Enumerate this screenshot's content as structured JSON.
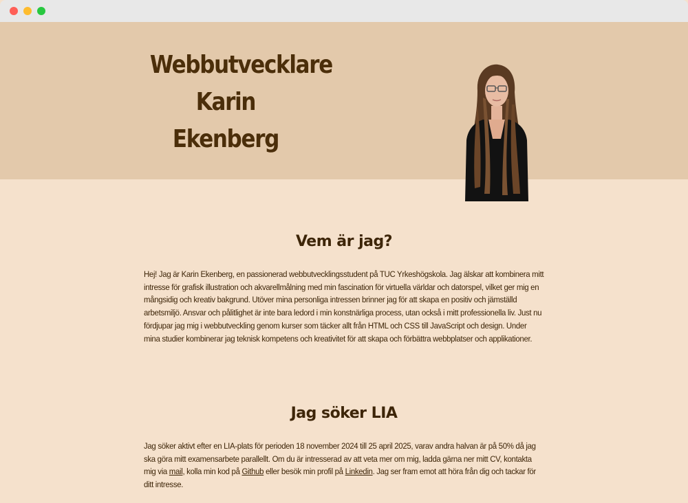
{
  "hero": {
    "title_line1": "Webbutvecklare",
    "title_line2": "Karin Ekenberg"
  },
  "about": {
    "heading": "Vem är jag?",
    "text": "Hej! Jag är Karin Ekenberg, en passionerad webbutvecklingsstudent på TUC Yrkeshögskola. Jag älskar att kombinera mitt intresse för grafisk illustration och akvarellmålning med min fascination för virtuella världar och datorspel, vilket ger mig en mångsidig och kreativ bakgrund. Utöver mina personliga intressen brinner jag för att skapa en positiv och jämställd arbetsmiljö. Ansvar och pålitlighet är inte bara ledord i min konstnärliga process, utan också i mitt professionella liv. Just nu fördjupar jag mig i webbutveckling genom kurser som täcker allt från HTML och CSS till JavaScript och design. Under mina studier kombinerar jag teknisk kompetens och kreativitet för att skapa och förbättra webbplatser och applikationer."
  },
  "lia": {
    "heading": "Jag söker LIA",
    "text_1": "Jag söker aktivt efter en LIA-plats för perioden 18 november 2024 till 25 april 2025, varav andra halvan är på 50% då jag ska göra mitt examensarbete parallellt. Om du är intresserad av att veta mer om mig, ladda gärna ner mitt CV, kontakta mig via ",
    "link_mail": "mail",
    "text_2": ", kolla min kod på ",
    "link_github": "Github",
    "text_3": " eller besök min profil på ",
    "link_linkedin": "Linkedin",
    "text_4": ". Jag ser fram emot att höra från dig och tackar för ditt intresse."
  },
  "colors": {
    "hero_bg": "#e3c9ab",
    "page_bg": "#f5e1cc",
    "text": "#3d2508",
    "heading": "#4b2e0a"
  }
}
